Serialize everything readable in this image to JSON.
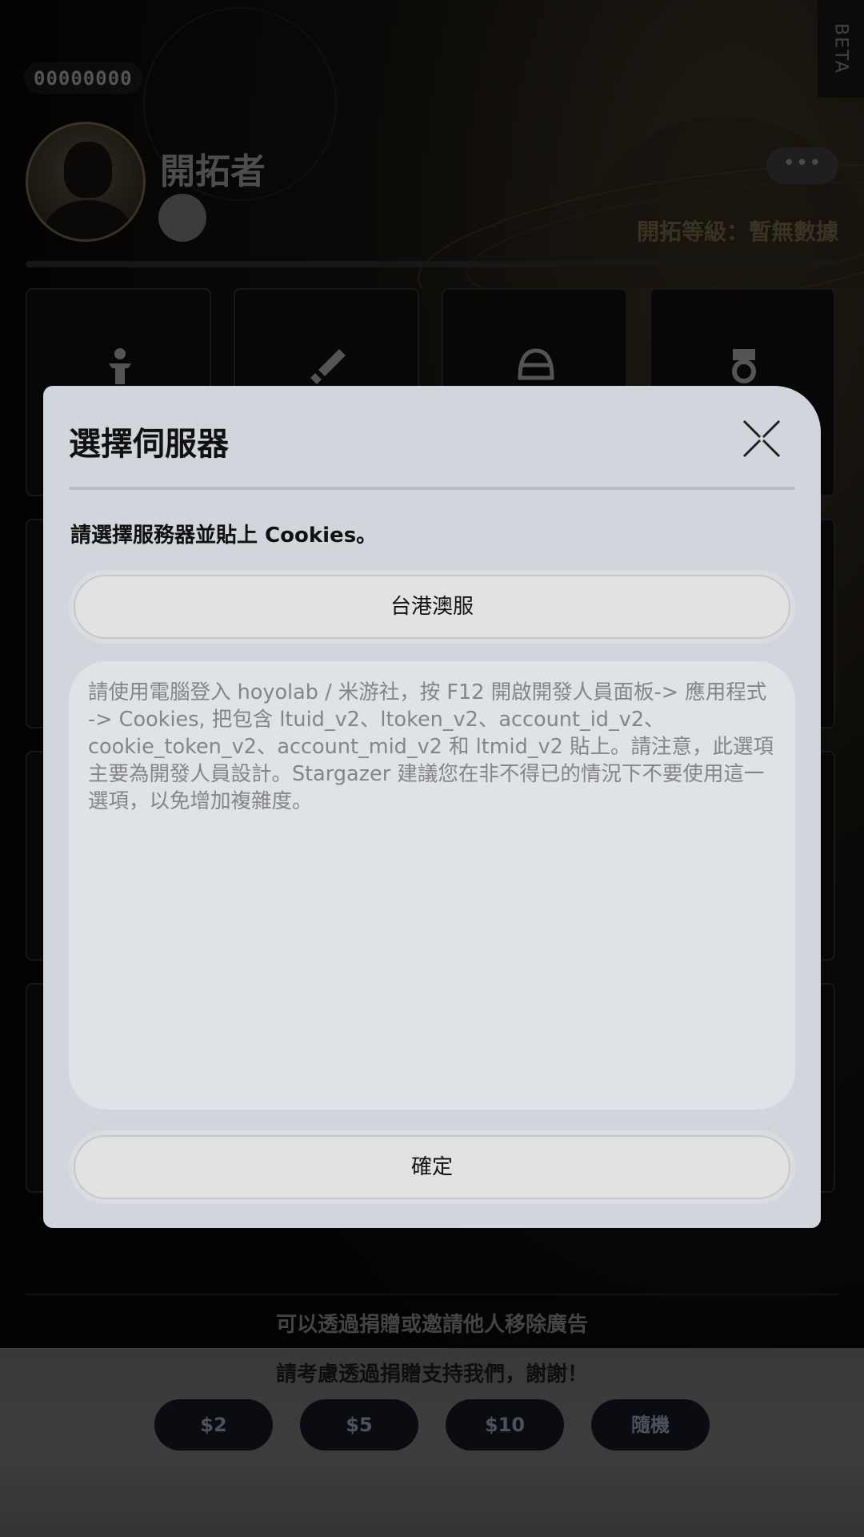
{
  "background": {
    "uid": "00000000",
    "beta_label": "BETA",
    "player_name": "開拓者",
    "more_label": "•••",
    "level_text": "開拓等級：暫無數據",
    "footer": {
      "remove_ads_text": "可以透過捐贈或邀請他人移除廣告",
      "support_text": "請考慮透過捐贈支持我們，謝謝！",
      "donate_buttons": [
        "$2",
        "$5",
        "$10",
        "隨機"
      ]
    }
  },
  "dialog": {
    "title": "選擇伺服器",
    "subtitle": "請選擇服務器並貼上 Cookies。",
    "server_button": "台港澳服",
    "cookie_placeholder": "請使用電腦登入 hoyolab / 米游社，按 F12 開啟開發人員面板-> 應用程式 -> Cookies, 把包含 ltuid_v2、ltoken_v2、account_id_v2、cookie_token_v2、account_mid_v2 和 ltmid_v2 貼上。請注意，此選項主要為開發人員設計。Stargazer 建議您在非不得已的情況下不要使用這一選項，以免增加複雜度。",
    "confirm_button": "確定"
  },
  "icons": {
    "close": "close-icon",
    "cards": [
      "character-icon",
      "sword-icon",
      "helmet-icon",
      "medal-icon"
    ]
  }
}
